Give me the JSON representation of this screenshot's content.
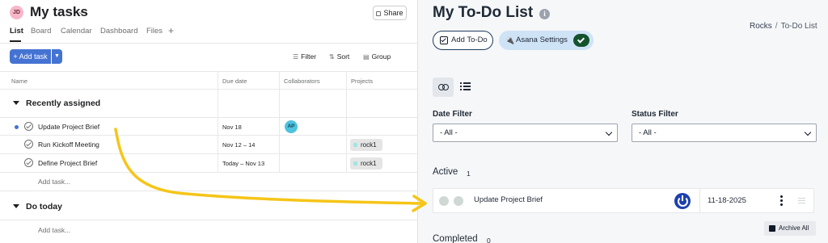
{
  "left": {
    "avatar_initials": "JD",
    "title": "My tasks",
    "share_label": "Share",
    "tabs": [
      "List",
      "Board",
      "Calendar",
      "Dashboard",
      "Files",
      "+"
    ],
    "toolbar": {
      "add_task": "+ Add task",
      "filter": "Filter",
      "sort": "Sort",
      "group": "Group"
    },
    "columns": [
      "Name",
      "Due date",
      "Collaborators",
      "Projects"
    ],
    "sections": [
      {
        "title": "Recently assigned",
        "tasks": [
          {
            "name": "Update Project Brief",
            "due": "Nov 18",
            "collaborator": "AP",
            "project": ""
          },
          {
            "name": "Run Kickoff Meeting",
            "due": "Nov 12 – 14",
            "collaborator": "",
            "project": "rock1"
          },
          {
            "name": "Define Project Brief",
            "due": "Today – Nov 13",
            "collaborator": "",
            "project": "rock1"
          }
        ],
        "add_task": "Add task..."
      },
      {
        "title": "Do today",
        "tasks": [],
        "add_task": "Add task..."
      }
    ]
  },
  "right": {
    "title": "My To-Do List",
    "breadcrumb": [
      "Rocks",
      "To-Do List"
    ],
    "buttons": {
      "add_todo": "Add To-Do",
      "asana_settings": "Asana Settings"
    },
    "filters": {
      "date_label": "Date Filter",
      "date_value": "- All -",
      "status_label": "Status Filter",
      "status_value": "- All -"
    },
    "active": {
      "label": "Active",
      "count": "1",
      "items": [
        {
          "name": "Update Project Brief",
          "date": "11-18-2025"
        }
      ]
    },
    "archive_all": "Archive All",
    "completed": {
      "label": "Completed",
      "count": "0"
    }
  },
  "colors": {
    "asana_blue": "#4573d2",
    "annotation_arrow": "#f5c518",
    "power_icon": "#1e40af",
    "settings_pill": "#cfe3f7",
    "settings_ok": "#14532d"
  }
}
